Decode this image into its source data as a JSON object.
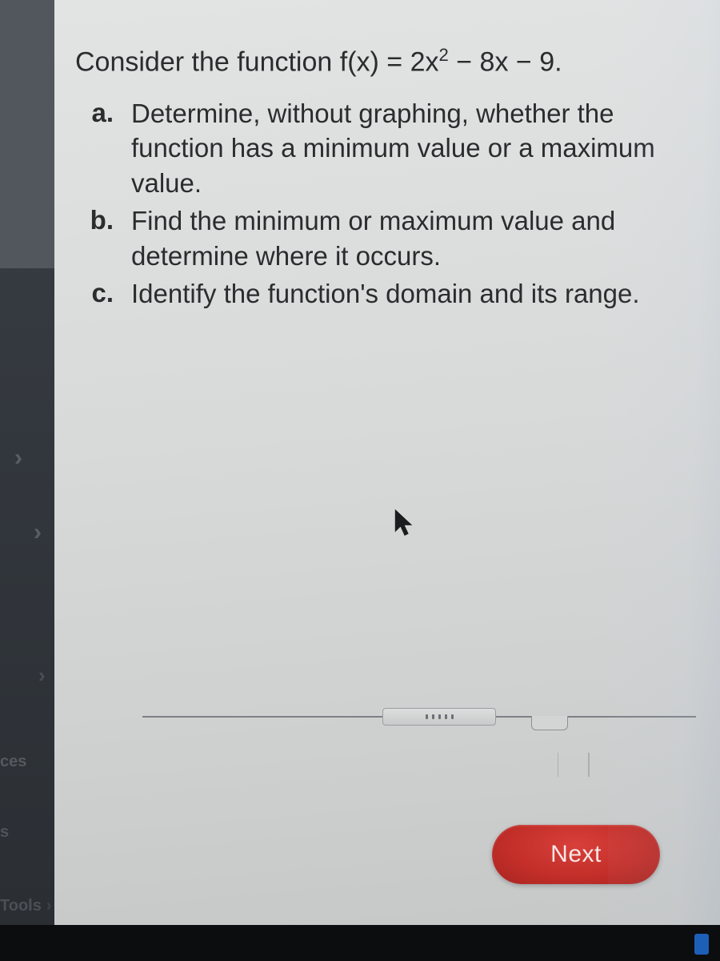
{
  "sidebar": {
    "chevron": "›",
    "item_ces": "ces",
    "item_s": "s",
    "item_tools": "Tools"
  },
  "question": {
    "intro_prefix": "Consider the function f(x) = 2x",
    "intro_exp": "2",
    "intro_suffix": " − 8x − 9.",
    "items": [
      {
        "label": "a.",
        "text": "Determine, without graphing, whether the function has a minimum value or a maximum value."
      },
      {
        "label": "b.",
        "text": "Find the minimum or maximum value and determine where it occurs."
      },
      {
        "label": "c.",
        "text": "Identify the function's domain and its range."
      }
    ]
  },
  "controls": {
    "next_label": "Next"
  }
}
